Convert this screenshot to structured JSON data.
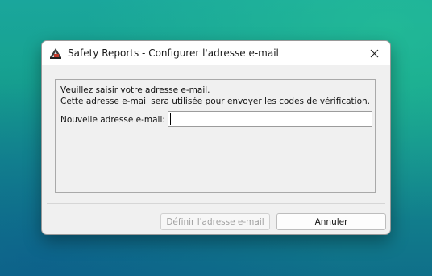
{
  "window": {
    "title": "Safety Reports - Configurer l'adresse e-mail",
    "icon": "safety-reports-app-icon",
    "close_icon": "close-icon"
  },
  "dialog": {
    "message_line1": "Veuillez saisir votre adresse e-mail.",
    "message_line2": "Cette adresse e-mail sera utilisée pour envoyer les codes de vérification.",
    "email_label": "Nouvelle adresse e-mail:",
    "email_value": "",
    "email_placeholder": ""
  },
  "buttons": {
    "define_label": "Définir l'adresse e-mail",
    "define_enabled": false,
    "cancel_label": "Annuler"
  }
}
